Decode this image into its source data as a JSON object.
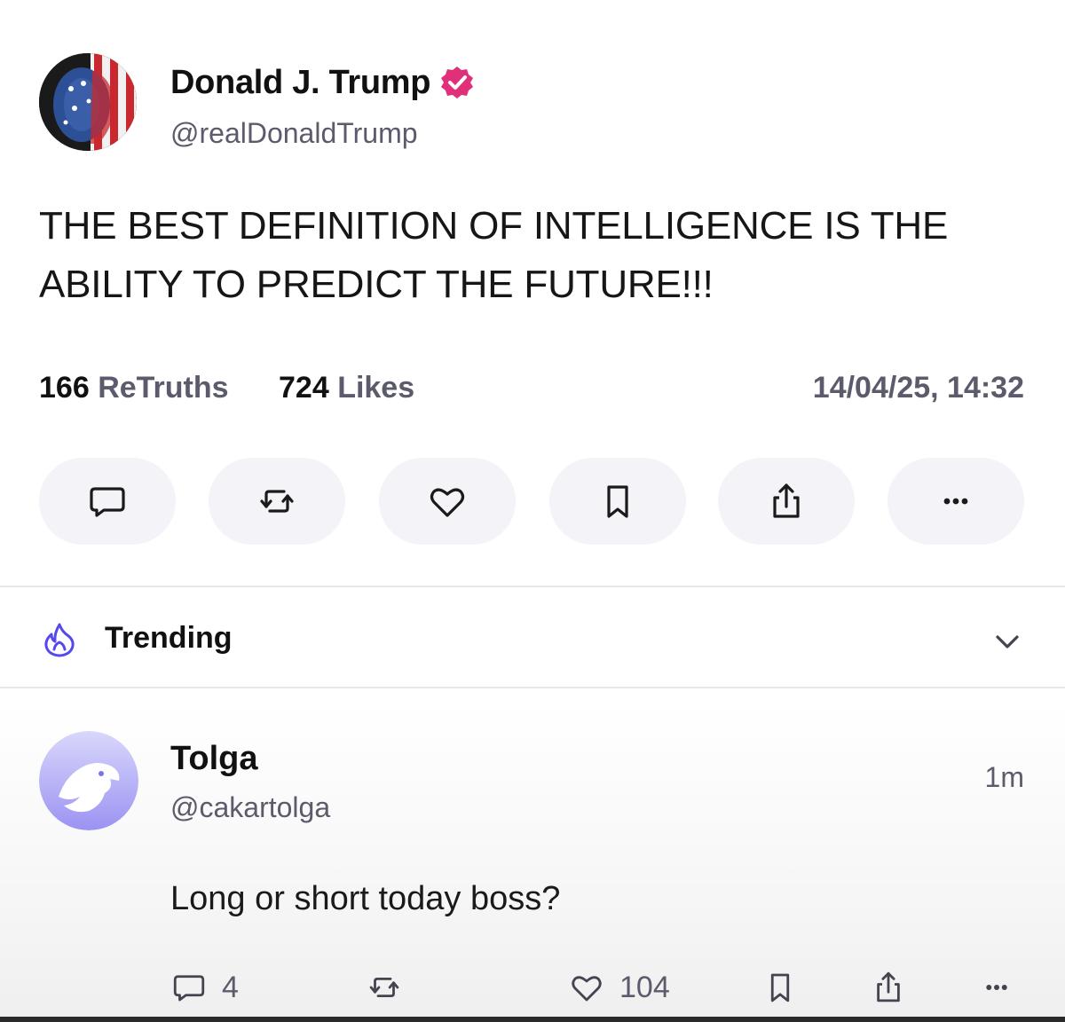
{
  "post": {
    "display_name": "Donald J. Trump",
    "handle": "@realDonaldTrump",
    "verified_icon": "verified-badge-icon",
    "body": "THE BEST DEFINITION OF INTELLIGENCE IS THE ABILITY TO PREDICT THE FUTURE!!!",
    "retruths_count": "166",
    "retruths_label": "ReTruths",
    "likes_count": "724",
    "likes_label": "Likes",
    "timestamp": "14/04/25, 14:32",
    "actions": [
      "reply-icon",
      "retruth-icon",
      "heart-icon",
      "bookmark-icon",
      "share-icon",
      "more-icon"
    ]
  },
  "trending": {
    "label": "Trending",
    "icon": "flame-icon"
  },
  "reply": {
    "display_name": "Tolga",
    "handle": "@cakartolga",
    "time": "1m",
    "body": "Long or short today boss?",
    "reply_count": "4",
    "like_count": "104"
  },
  "colors": {
    "verified": "#e0307a",
    "accent": "#5448ee",
    "muted_text": "#5b5b6b",
    "button_bg": "#f4f3f8"
  }
}
